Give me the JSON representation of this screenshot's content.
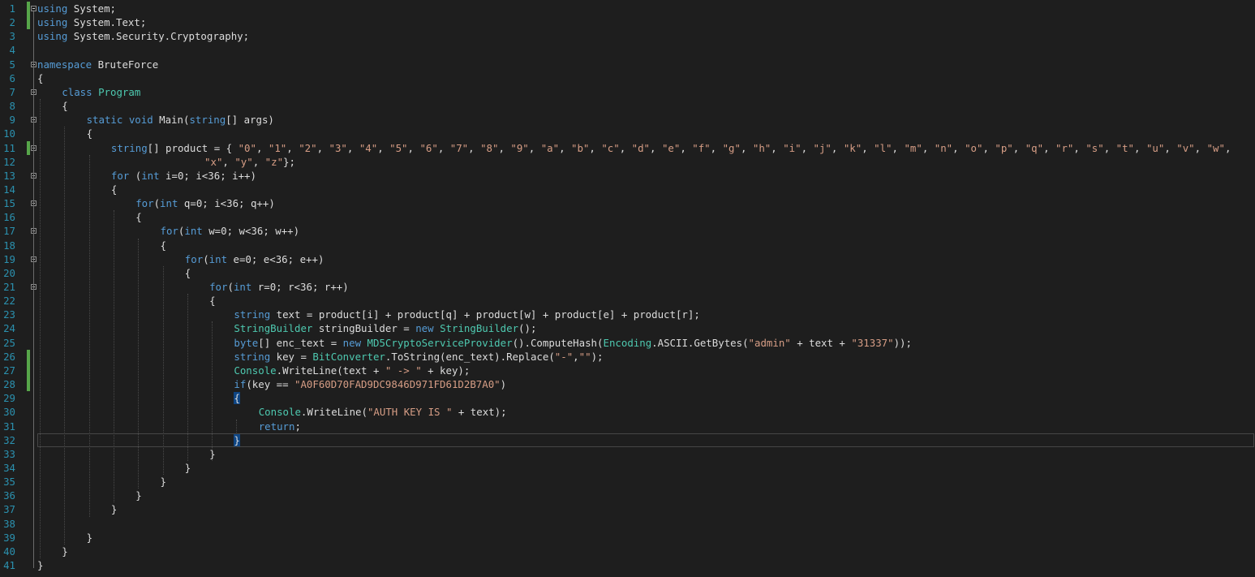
{
  "editor": {
    "colors": {
      "background": "#1e1e1e",
      "line_number": "#2b91af",
      "keyword": "#569cd6",
      "type": "#4ec9b0",
      "string": "#d69d85",
      "number": "#b5cea8",
      "text": "#dcdcdc",
      "change_marker": "#57a64a"
    },
    "current_line": 32,
    "changed_lines": [
      1,
      2,
      11,
      26,
      27,
      28
    ],
    "fold_markers": [
      1,
      5,
      7,
      9,
      11,
      13,
      15,
      17,
      19,
      21
    ],
    "lines": [
      {
        "n": "1",
        "indent": 0,
        "tokens": [
          [
            "kw",
            "using"
          ],
          [
            "tx",
            " System;"
          ]
        ]
      },
      {
        "n": "2",
        "indent": 0,
        "tokens": [
          [
            "kw",
            "using"
          ],
          [
            "tx",
            " System.Text;"
          ]
        ]
      },
      {
        "n": "3",
        "indent": 0,
        "tokens": [
          [
            "kw",
            "using"
          ],
          [
            "tx",
            " System.Security.Cryptography;"
          ]
        ]
      },
      {
        "n": "4",
        "indent": 0,
        "tokens": []
      },
      {
        "n": "5",
        "indent": 0,
        "tokens": [
          [
            "kw",
            "namespace"
          ],
          [
            "tx",
            " BruteForce"
          ]
        ]
      },
      {
        "n": "6",
        "indent": 0,
        "tokens": [
          [
            "tx",
            "{"
          ]
        ]
      },
      {
        "n": "7",
        "indent": 1,
        "tokens": [
          [
            "kw",
            "class"
          ],
          [
            "tx",
            " "
          ],
          [
            "ty",
            "Program"
          ]
        ]
      },
      {
        "n": "8",
        "indent": 1,
        "tokens": [
          [
            "tx",
            "{"
          ]
        ]
      },
      {
        "n": "9",
        "indent": 2,
        "tokens": [
          [
            "kw",
            "static"
          ],
          [
            "tx",
            " "
          ],
          [
            "kw",
            "void"
          ],
          [
            "tx",
            " Main("
          ],
          [
            "kw",
            "string"
          ],
          [
            "tx",
            "[] args)"
          ]
        ]
      },
      {
        "n": "10",
        "indent": 2,
        "tokens": [
          [
            "tx",
            "{"
          ]
        ]
      },
      {
        "n": "11",
        "indent": 3,
        "tokens": [
          [
            "kw",
            "string"
          ],
          [
            "tx",
            "[] product = { "
          ],
          [
            "st",
            "\"0\""
          ],
          [
            "tx",
            ", "
          ],
          [
            "st",
            "\"1\""
          ],
          [
            "tx",
            ", "
          ],
          [
            "st",
            "\"2\""
          ],
          [
            "tx",
            ", "
          ],
          [
            "st",
            "\"3\""
          ],
          [
            "tx",
            ", "
          ],
          [
            "st",
            "\"4\""
          ],
          [
            "tx",
            ", "
          ],
          [
            "st",
            "\"5\""
          ],
          [
            "tx",
            ", "
          ],
          [
            "st",
            "\"6\""
          ],
          [
            "tx",
            ", "
          ],
          [
            "st",
            "\"7\""
          ],
          [
            "tx",
            ", "
          ],
          [
            "st",
            "\"8\""
          ],
          [
            "tx",
            ", "
          ],
          [
            "st",
            "\"9\""
          ],
          [
            "tx",
            ", "
          ],
          [
            "st",
            "\"a\""
          ],
          [
            "tx",
            ", "
          ],
          [
            "st",
            "\"b\""
          ],
          [
            "tx",
            ", "
          ],
          [
            "st",
            "\"c\""
          ],
          [
            "tx",
            ", "
          ],
          [
            "st",
            "\"d\""
          ],
          [
            "tx",
            ", "
          ],
          [
            "st",
            "\"e\""
          ],
          [
            "tx",
            ", "
          ],
          [
            "st",
            "\"f\""
          ],
          [
            "tx",
            ", "
          ],
          [
            "st",
            "\"g\""
          ],
          [
            "tx",
            ", "
          ],
          [
            "st",
            "\"h\""
          ],
          [
            "tx",
            ", "
          ],
          [
            "st",
            "\"i\""
          ],
          [
            "tx",
            ", "
          ],
          [
            "st",
            "\"j\""
          ],
          [
            "tx",
            ", "
          ],
          [
            "st",
            "\"k\""
          ],
          [
            "tx",
            ", "
          ],
          [
            "st",
            "\"l\""
          ],
          [
            "tx",
            ", "
          ],
          [
            "st",
            "\"m\""
          ],
          [
            "tx",
            ", "
          ],
          [
            "st",
            "\"n\""
          ],
          [
            "tx",
            ", "
          ],
          [
            "st",
            "\"o\""
          ],
          [
            "tx",
            ", "
          ],
          [
            "st",
            "\"p\""
          ],
          [
            "tx",
            ", "
          ],
          [
            "st",
            "\"q\""
          ],
          [
            "tx",
            ", "
          ],
          [
            "st",
            "\"r\""
          ],
          [
            "tx",
            ", "
          ],
          [
            "st",
            "\"s\""
          ],
          [
            "tx",
            ", "
          ],
          [
            "st",
            "\"t\""
          ],
          [
            "tx",
            ", "
          ],
          [
            "st",
            "\"u\""
          ],
          [
            "tx",
            ", "
          ],
          [
            "st",
            "\"v\""
          ],
          [
            "tx",
            ", "
          ],
          [
            "st",
            "\"w\""
          ],
          [
            "tx",
            ","
          ]
        ]
      },
      {
        "n": "12",
        "indent": 6.8,
        "tokens": [
          [
            "st",
            "\"x\""
          ],
          [
            "tx",
            ", "
          ],
          [
            "st",
            "\"y\""
          ],
          [
            "tx",
            ", "
          ],
          [
            "st",
            "\"z\""
          ],
          [
            "tx",
            "};"
          ]
        ]
      },
      {
        "n": "13",
        "indent": 3,
        "tokens": [
          [
            "kw",
            "for"
          ],
          [
            "tx",
            " ("
          ],
          [
            "kw",
            "int"
          ],
          [
            "tx",
            " i=0; i<36; i++)"
          ]
        ]
      },
      {
        "n": "14",
        "indent": 3,
        "tokens": [
          [
            "tx",
            "{"
          ]
        ]
      },
      {
        "n": "15",
        "indent": 4,
        "tokens": [
          [
            "kw",
            "for"
          ],
          [
            "tx",
            "("
          ],
          [
            "kw",
            "int"
          ],
          [
            "tx",
            " q=0; i<36; q++)"
          ]
        ]
      },
      {
        "n": "16",
        "indent": 4,
        "tokens": [
          [
            "tx",
            "{"
          ]
        ]
      },
      {
        "n": "17",
        "indent": 5,
        "tokens": [
          [
            "kw",
            "for"
          ],
          [
            "tx",
            "("
          ],
          [
            "kw",
            "int"
          ],
          [
            "tx",
            " w=0; w<36; w++)"
          ]
        ]
      },
      {
        "n": "18",
        "indent": 5,
        "tokens": [
          [
            "tx",
            "{"
          ]
        ]
      },
      {
        "n": "19",
        "indent": 6,
        "tokens": [
          [
            "kw",
            "for"
          ],
          [
            "tx",
            "("
          ],
          [
            "kw",
            "int"
          ],
          [
            "tx",
            " e=0; e<36; e++)"
          ]
        ]
      },
      {
        "n": "20",
        "indent": 6,
        "tokens": [
          [
            "tx",
            "{"
          ]
        ]
      },
      {
        "n": "21",
        "indent": 7,
        "tokens": [
          [
            "kw",
            "for"
          ],
          [
            "tx",
            "("
          ],
          [
            "kw",
            "int"
          ],
          [
            "tx",
            " r=0; r<36; r++)"
          ]
        ]
      },
      {
        "n": "22",
        "indent": 7,
        "tokens": [
          [
            "tx",
            "{"
          ]
        ]
      },
      {
        "n": "23",
        "indent": 8,
        "tokens": [
          [
            "kw",
            "string"
          ],
          [
            "tx",
            " text = product[i] + product[q] + product[w] + product[e] + product[r];"
          ]
        ]
      },
      {
        "n": "24",
        "indent": 8,
        "tokens": [
          [
            "ty",
            "StringBuilder"
          ],
          [
            "tx",
            " stringBuilder = "
          ],
          [
            "kw",
            "new"
          ],
          [
            "tx",
            " "
          ],
          [
            "ty",
            "StringBuilder"
          ],
          [
            "tx",
            "();"
          ]
        ]
      },
      {
        "n": "25",
        "indent": 8,
        "tokens": [
          [
            "kw",
            "byte"
          ],
          [
            "tx",
            "[] enc_text = "
          ],
          [
            "kw",
            "new"
          ],
          [
            "tx",
            " "
          ],
          [
            "ty",
            "MD5CryptoServiceProvider"
          ],
          [
            "tx",
            "().ComputeHash("
          ],
          [
            "ty",
            "Encoding"
          ],
          [
            "tx",
            ".ASCII.GetBytes("
          ],
          [
            "st",
            "\"admin\""
          ],
          [
            "tx",
            " + text + "
          ],
          [
            "st",
            "\"31337\""
          ],
          [
            "tx",
            "));"
          ]
        ]
      },
      {
        "n": "26",
        "indent": 8,
        "tokens": [
          [
            "kw",
            "string"
          ],
          [
            "tx",
            " key = "
          ],
          [
            "ty",
            "BitConverter"
          ],
          [
            "tx",
            ".ToString(enc_text).Replace("
          ],
          [
            "st",
            "\"-\""
          ],
          [
            "tx",
            ","
          ],
          [
            "st",
            "\"\""
          ],
          [
            "tx",
            ");"
          ]
        ]
      },
      {
        "n": "27",
        "indent": 8,
        "tokens": [
          [
            "ty",
            "Console"
          ],
          [
            "tx",
            ".WriteLine(text + "
          ],
          [
            "st",
            "\" -> \""
          ],
          [
            "tx",
            " + key);"
          ]
        ]
      },
      {
        "n": "28",
        "indent": 8,
        "tokens": [
          [
            "kw",
            "if"
          ],
          [
            "tx",
            "(key == "
          ],
          [
            "st",
            "\"A0F60D70FAD9DC9846D971FD61D2B7A0\""
          ],
          [
            "tx",
            ")"
          ]
        ]
      },
      {
        "n": "29",
        "indent": 8,
        "tokens": [
          [
            "br",
            "{"
          ]
        ]
      },
      {
        "n": "30",
        "indent": 9,
        "tokens": [
          [
            "ty",
            "Console"
          ],
          [
            "tx",
            ".WriteLine("
          ],
          [
            "st",
            "\"AUTH KEY IS \""
          ],
          [
            "tx",
            " + text);"
          ]
        ]
      },
      {
        "n": "31",
        "indent": 9,
        "tokens": [
          [
            "kw",
            "return"
          ],
          [
            "tx",
            ";"
          ]
        ]
      },
      {
        "n": "32",
        "indent": 8,
        "tokens": [
          [
            "br",
            "}"
          ]
        ]
      },
      {
        "n": "33",
        "indent": 7,
        "tokens": [
          [
            "tx",
            "}"
          ]
        ]
      },
      {
        "n": "34",
        "indent": 6,
        "tokens": [
          [
            "tx",
            "}"
          ]
        ]
      },
      {
        "n": "35",
        "indent": 5,
        "tokens": [
          [
            "tx",
            "}"
          ]
        ]
      },
      {
        "n": "36",
        "indent": 4,
        "tokens": [
          [
            "tx",
            "}"
          ]
        ]
      },
      {
        "n": "37",
        "indent": 3,
        "tokens": [
          [
            "tx",
            "}"
          ]
        ]
      },
      {
        "n": "38",
        "indent": 0,
        "tokens": []
      },
      {
        "n": "39",
        "indent": 2,
        "tokens": [
          [
            "tx",
            "}"
          ]
        ]
      },
      {
        "n": "40",
        "indent": 1,
        "tokens": [
          [
            "tx",
            "}"
          ]
        ]
      },
      {
        "n": "41",
        "indent": 0,
        "tokens": [
          [
            "tx",
            "}"
          ]
        ]
      }
    ]
  }
}
